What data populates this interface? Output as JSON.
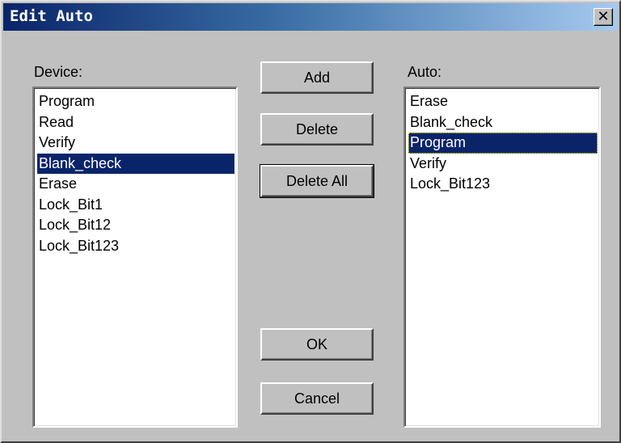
{
  "window": {
    "title": "Edit Auto",
    "close_glyph": "✕"
  },
  "device": {
    "label": "Device:",
    "items": [
      "Program",
      "Read",
      "Verify",
      "Blank_check",
      "Erase",
      "Lock_Bit1",
      "Lock_Bit12",
      "Lock_Bit123"
    ],
    "selected": "Blank_check"
  },
  "auto": {
    "label": "Auto:",
    "items": [
      "Erase",
      "Blank_check",
      "Program",
      "Verify",
      "Lock_Bit123"
    ],
    "selected": "Program"
  },
  "buttons": {
    "add": "Add",
    "delete": "Delete",
    "delete_all": "Delete All",
    "ok": "OK",
    "cancel": "Cancel"
  },
  "colors": {
    "titlebar_start": "#0a246a",
    "titlebar_end": "#a6caf0",
    "selection": "#0a246a",
    "face": "#c0c0c0"
  }
}
